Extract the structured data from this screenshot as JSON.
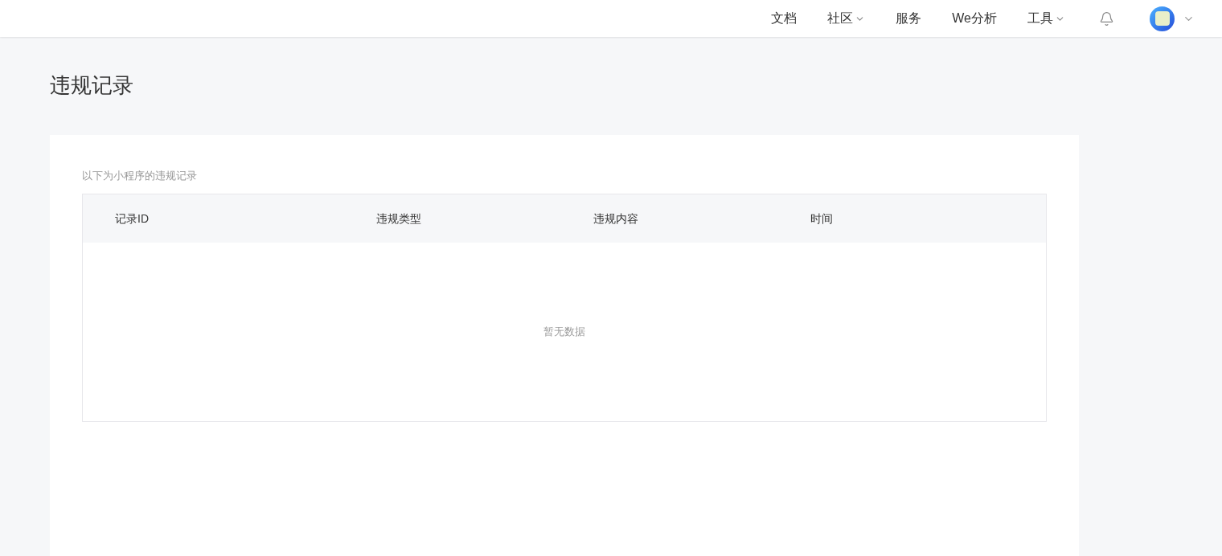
{
  "nav": {
    "items": [
      {
        "label": "文档",
        "dropdown": false
      },
      {
        "label": "社区",
        "dropdown": true
      },
      {
        "label": "服务",
        "dropdown": false
      },
      {
        "label": "We分析",
        "dropdown": false
      },
      {
        "label": "工具",
        "dropdown": true
      }
    ]
  },
  "page": {
    "title": "违规记录",
    "description": "以下为小程序的违规记录"
  },
  "table": {
    "columns": [
      "记录ID",
      "违规类型",
      "违规内容",
      "时间"
    ],
    "empty_text": "暂无数据"
  }
}
